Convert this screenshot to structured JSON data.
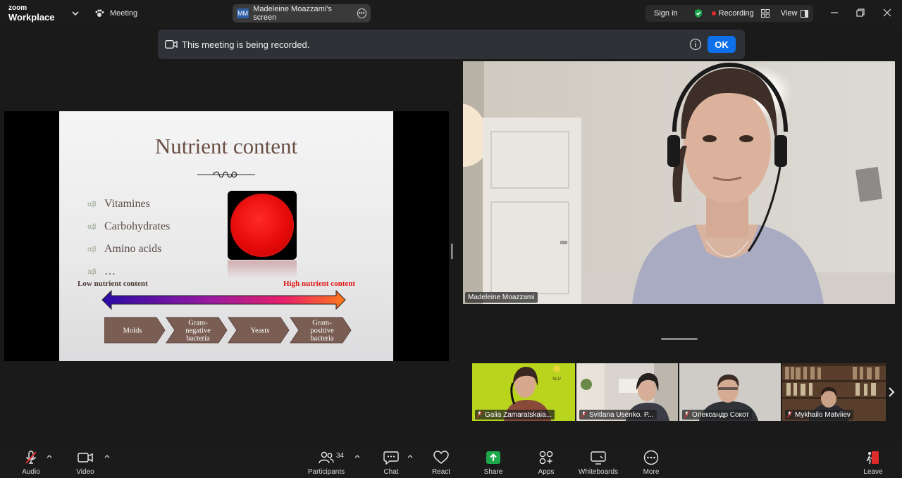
{
  "titlebar": {
    "logo_top": "zoom",
    "logo_bottom": "Workplace",
    "meeting_label": "Meeting",
    "screen_initials": "MM",
    "screen_label": "Madeleine Moazzami's screen",
    "sign_in": "Sign in",
    "recording": "Recording",
    "view": "View"
  },
  "banner": {
    "message": "This meeting is being recorded.",
    "ok": "OK"
  },
  "slide": {
    "title": "Nutrient content",
    "bullet_glyph": "αβ",
    "bullets": [
      "Vitamines",
      "Carbohydrates",
      "Amino acids",
      "…"
    ],
    "low_label": "Low nutrient content",
    "high_label": "High nutrient content",
    "chevrons": [
      {
        "lines": [
          "Molds"
        ]
      },
      {
        "lines": [
          "Gram-",
          "negative",
          "bacteria"
        ]
      },
      {
        "lines": [
          "Yeasts"
        ]
      },
      {
        "lines": [
          "Gram-",
          "positive",
          "bacteria"
        ]
      }
    ]
  },
  "main_video": {
    "name": "Madeleine Moazzami"
  },
  "thumbnails": [
    {
      "name": "Galia Zamaratskaia...",
      "logo_text": "SLU"
    },
    {
      "name": "Svitlana Usenko. P..."
    },
    {
      "name": "Олександр Сокот"
    },
    {
      "name": "Mykhailo Matviiev"
    }
  ],
  "toolbar": {
    "audio": "Audio",
    "video": "Video",
    "participants": "Participants",
    "participants_count": "34",
    "chat": "Chat",
    "react": "React",
    "share": "Share",
    "apps": "Apps",
    "whiteboards": "Whiteboards",
    "more": "More",
    "leave": "Leave"
  },
  "colors": {
    "accent_blue": "#0e71eb",
    "share_green": "#1ea84b",
    "recording_red": "#e02b2b",
    "leave_red": "#e02b2b",
    "slide_title": "#6a4e44",
    "high_label": "#e01616"
  }
}
